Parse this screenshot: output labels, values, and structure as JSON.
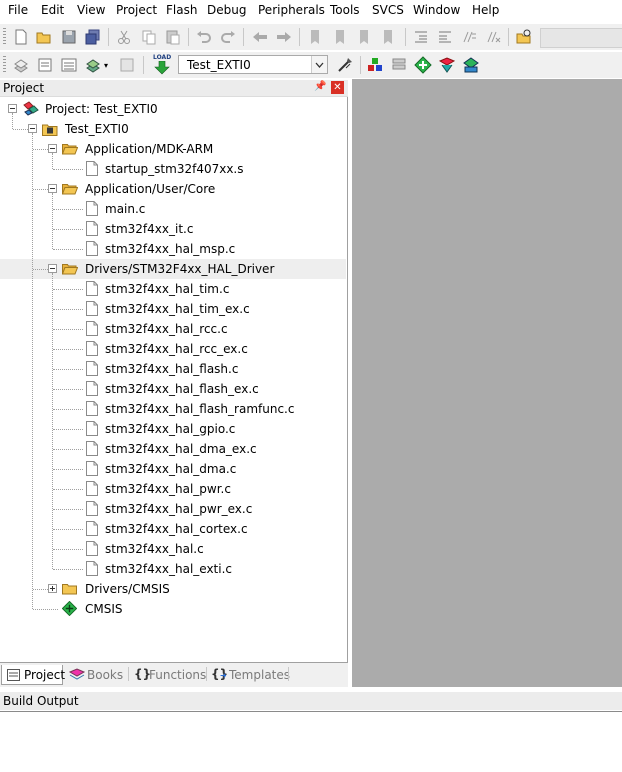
{
  "menu": [
    "File",
    "Edit",
    "View",
    "Project",
    "Flash",
    "Debug",
    "Peripherals",
    "Tools",
    "SVCS",
    "Window",
    "Help"
  ],
  "toolbar2": {
    "load_label": "LOAD",
    "target": "Test_EXTI0"
  },
  "project_panel": {
    "title": "Project",
    "tree": {
      "root": "Project: Test_EXTI0",
      "target": "Test_EXTI0",
      "groups": [
        {
          "name": "Application/MDK-ARM",
          "files": [
            "startup_stm32f407xx.s"
          ]
        },
        {
          "name": "Application/User/Core",
          "files": [
            "main.c",
            "stm32f4xx_it.c",
            "stm32f4xx_hal_msp.c"
          ]
        },
        {
          "name": "Drivers/STM32F4xx_HAL_Driver",
          "files": [
            "stm32f4xx_hal_tim.c",
            "stm32f4xx_hal_tim_ex.c",
            "stm32f4xx_hal_rcc.c",
            "stm32f4xx_hal_rcc_ex.c",
            "stm32f4xx_hal_flash.c",
            "stm32f4xx_hal_flash_ex.c",
            "stm32f4xx_hal_flash_ramfunc.c",
            "stm32f4xx_hal_gpio.c",
            "stm32f4xx_hal_dma_ex.c",
            "stm32f4xx_hal_dma.c",
            "stm32f4xx_hal_pwr.c",
            "stm32f4xx_hal_pwr_ex.c",
            "stm32f4xx_hal_cortex.c",
            "stm32f4xx_hal.c",
            "stm32f4xx_hal_exti.c"
          ]
        },
        {
          "name": "Drivers/CMSIS",
          "files": []
        }
      ],
      "component": "CMSIS"
    },
    "tabs": [
      "Project",
      "Books",
      "Functions",
      "Templates"
    ]
  },
  "build_output": {
    "title": "Build Output"
  },
  "colors": {
    "selected_row": "#eeeeee",
    "editor_bg": "#ababab",
    "folder": "#f3c653"
  }
}
